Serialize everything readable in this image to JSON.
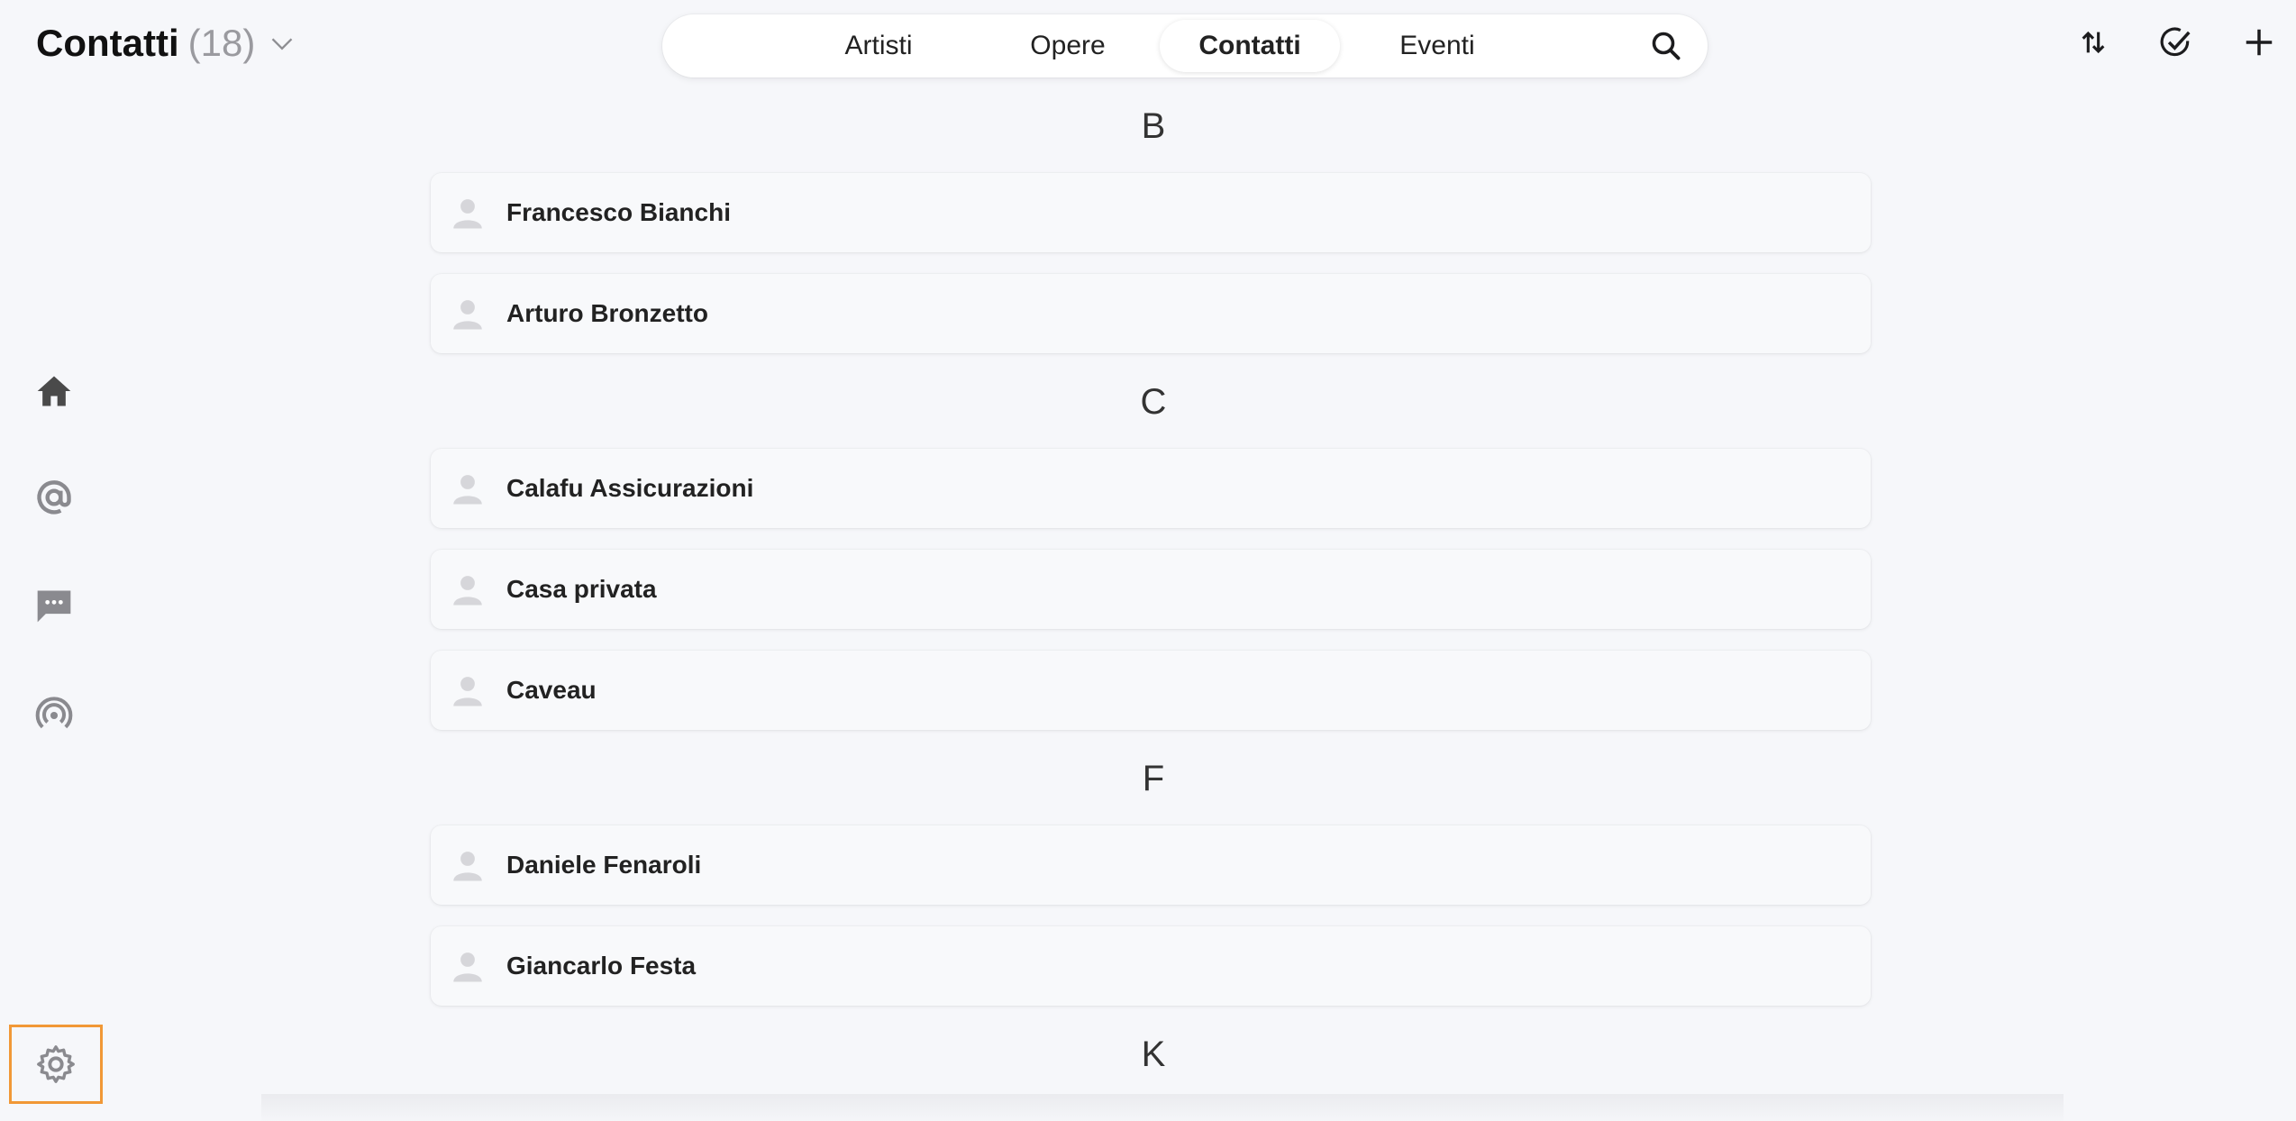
{
  "header": {
    "title": "Contatti",
    "count": "(18)"
  },
  "tabs": [
    {
      "label": "Artisti",
      "active": false
    },
    {
      "label": "Opere",
      "active": false
    },
    {
      "label": "Contatti",
      "active": true
    },
    {
      "label": "Eventi",
      "active": false
    }
  ],
  "top_actions": [
    "sort-icon",
    "check-circle-icon",
    "plus-icon"
  ],
  "rail": [
    "home-icon",
    "at-icon",
    "chat-icon",
    "broadcast-icon",
    "gear-icon"
  ],
  "sections": [
    {
      "letter": "B",
      "contacts": [
        "Francesco Bianchi",
        "Arturo Bronzetto"
      ]
    },
    {
      "letter": "C",
      "contacts": [
        "Calafu Assicurazioni",
        "Casa privata",
        "Caveau"
      ]
    },
    {
      "letter": "F",
      "contacts": [
        "Daniele Fenaroli",
        "Giancarlo Festa"
      ]
    },
    {
      "letter": "K",
      "contacts": []
    }
  ],
  "colors": {
    "background": "#f6f7fa",
    "highlight": "#f19836",
    "icon": "#4a4a4a"
  }
}
